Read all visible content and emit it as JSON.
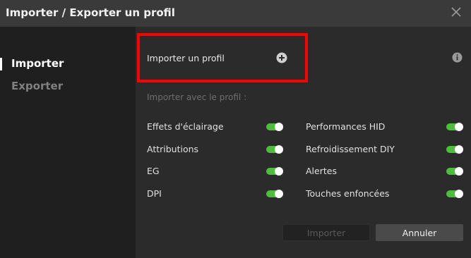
{
  "window": {
    "title": "Importer / Exporter un profil",
    "close_icon": "close-icon"
  },
  "sidebar": {
    "items": [
      {
        "label": "Importer",
        "active": true
      },
      {
        "label": "Exporter",
        "active": false
      }
    ]
  },
  "import": {
    "label": "Importer un profil",
    "add_icon": "plus-circle-icon",
    "info_icon": "info-icon",
    "highlight_color": "#ff0000"
  },
  "options": {
    "section_label": "Importer avec le profil :",
    "left": [
      {
        "label": "Effets d'éclairage",
        "enabled": true
      },
      {
        "label": "Attributions",
        "enabled": true
      },
      {
        "label": "EG",
        "enabled": true
      },
      {
        "label": "DPI",
        "enabled": true
      }
    ],
    "right": [
      {
        "label": "Performances HID",
        "enabled": true
      },
      {
        "label": "Refroidissement DIY",
        "enabled": true
      },
      {
        "label": "Alertes",
        "enabled": true
      },
      {
        "label": "Touches enfoncées",
        "enabled": true
      }
    ],
    "toggle_on_color": "#4dbe3c"
  },
  "buttons": {
    "import_label": "Importer",
    "import_enabled": false,
    "cancel_label": "Annuler"
  }
}
